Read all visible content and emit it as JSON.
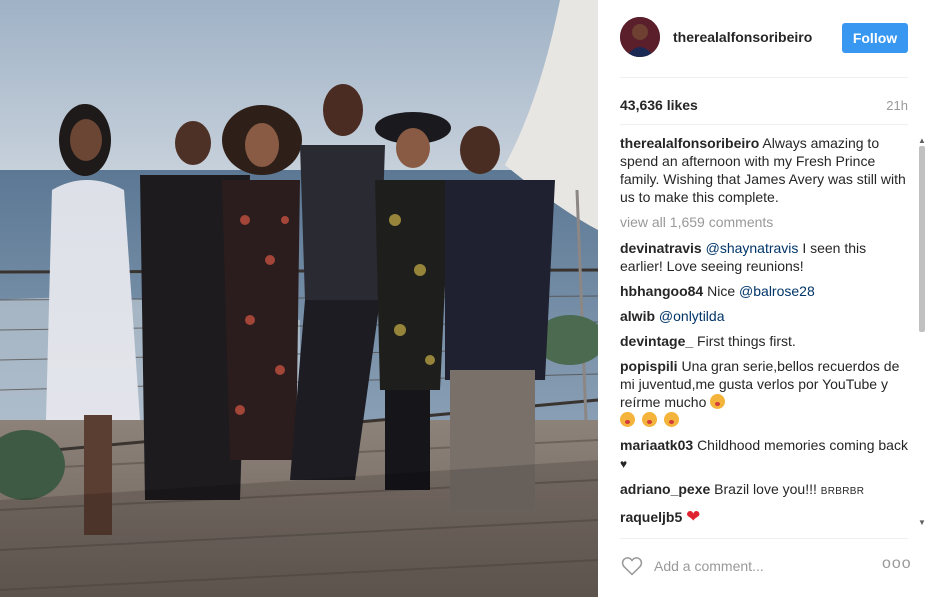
{
  "post": {
    "username": "therealalfonsoribeiro",
    "follow_label": "Follow",
    "likes": "43,636 likes",
    "time_ago": "21h",
    "caption_user": "therealalfonsoribeiro",
    "caption_text": "Always amazing to spend an afternoon with my Fresh Prince family. Wishing that James Avery was still with us to make this complete.",
    "view_all": "view all 1,659 comments"
  },
  "comments": [
    {
      "user": "devinatravis",
      "mention": "@shaynatravis",
      "text": "I seen this earlier! Love seeing reunions!"
    },
    {
      "user": "hbhangoo84",
      "text": "Nice",
      "mention": "@balrose28"
    },
    {
      "user": "alwib",
      "mention": "@onlytilda"
    },
    {
      "user": "devintage_",
      "text": "First things first."
    },
    {
      "user": "popispili",
      "text": "Una gran serie,bellos recuerdos de mi juventud,me gusta verlos por YouTube y reírme mucho"
    },
    {
      "user": "mariaatk03",
      "text": "Childhood memories coming back",
      "symbol": "♥"
    },
    {
      "user": "adriano_pexe",
      "text": "Brazil love you!!!",
      "small": "BRBRBR"
    },
    {
      "user": "raqueljb5",
      "symbol": "❤"
    }
  ],
  "footer": {
    "placeholder": "Add a comment...",
    "more": "ooo"
  },
  "icons": {
    "like": "heart-outline-icon",
    "more": "more-options-icon",
    "scroll_up": "scroll-up-arrow",
    "scroll_down": "scroll-down-arrow"
  },
  "colors": {
    "follow_button": "#3897f0",
    "mention": "#003569",
    "muted": "#999999"
  }
}
